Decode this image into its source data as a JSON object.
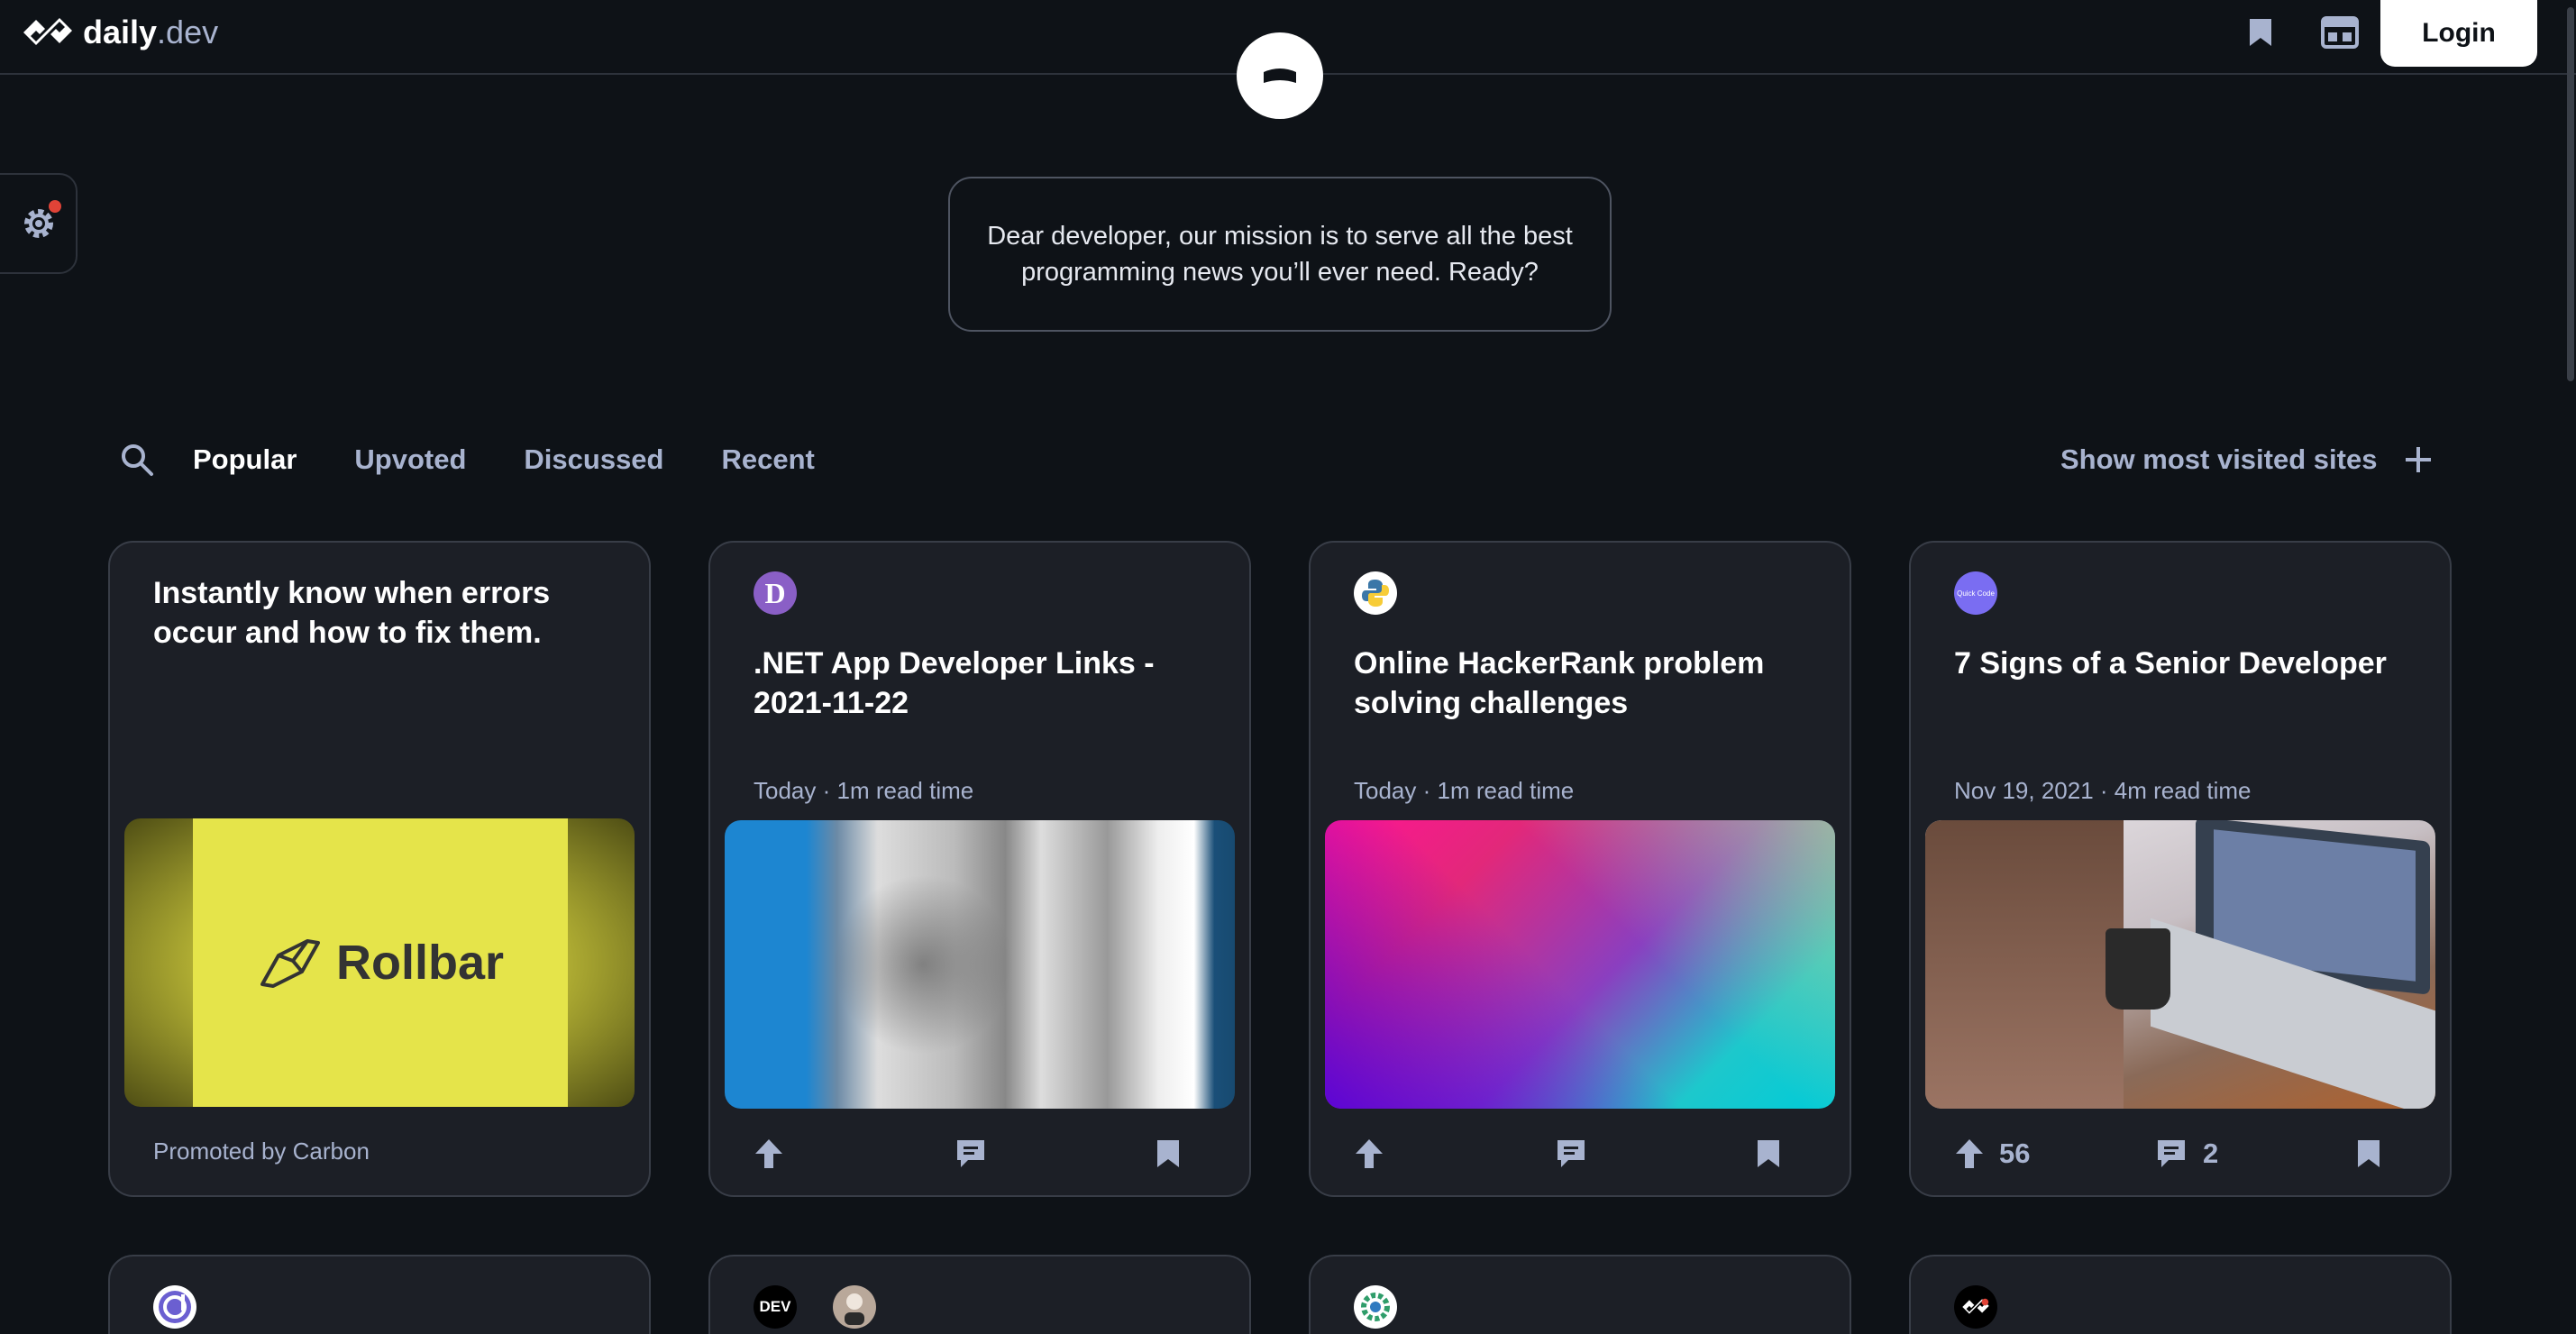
{
  "header": {
    "logo_main": "daily",
    "logo_suffix": ".dev",
    "login_label": "Login",
    "icons": [
      "bookmark-icon",
      "layout-icon"
    ]
  },
  "settings": {
    "icon": "gear-icon",
    "has_notification": true
  },
  "mission": {
    "text": "Dear developer, our mission is to serve all the best programming news you’ll ever need. Ready?"
  },
  "feed_nav": {
    "search_icon": "search-icon",
    "tabs": [
      {
        "label": "Popular",
        "active": true
      },
      {
        "label": "Upvoted",
        "active": false
      },
      {
        "label": "Discussed",
        "active": false
      },
      {
        "label": "Recent",
        "active": false
      }
    ],
    "most_visited_label": "Show most visited sites"
  },
  "cards": [
    {
      "title": "Instantly know when errors occur and how to fix them.",
      "image_text": "Rollbar",
      "promoted": "Promoted by Carbon"
    },
    {
      "source_letter": "D",
      "title": ".NET App Developer Links - 2021-11-22",
      "meta": "Today · 1m read time"
    },
    {
      "title": "Online HackerRank problem solving challenges",
      "meta": "Today · 1m read time"
    },
    {
      "source_text": "Quick Code",
      "title": "7 Signs of a Senior Developer",
      "meta": "Nov 19, 2021 · 4m read time",
      "upvotes": "56",
      "comments": "2"
    }
  ],
  "bottom_cards": [
    {
      "source": "daily-dev-icon"
    },
    {
      "source_text": "DEV"
    },
    {
      "source": "gear-green-icon"
    },
    {
      "source": "daily-logo-icon"
    }
  ],
  "colors": {
    "background": "#0e1217",
    "card": "#1c1f26",
    "border": "#383d47",
    "text_secondary": "#a8b3cf",
    "notification": "#e04337"
  }
}
